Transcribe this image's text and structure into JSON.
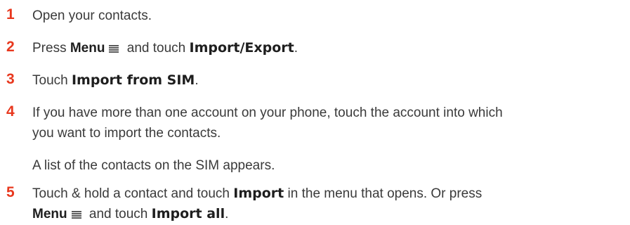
{
  "steps": [
    {
      "number": "1",
      "text": "Open your contacts."
    },
    {
      "number": "2",
      "pre": "Press ",
      "menu": "Menu",
      "mid": " and touch ",
      "target": "Import/Export",
      "post": "."
    },
    {
      "number": "3",
      "pre": "Touch ",
      "target": "Import from SIM",
      "post": "."
    },
    {
      "number": "4",
      "line1": "If you have more than one account on your phone, touch the account into which",
      "line2": "you want to import the contacts.",
      "note": "A list of the contacts on the SIM appears."
    },
    {
      "number": "5",
      "pre": "Touch & hold a contact and touch ",
      "target": "Import",
      "mid": " in the menu that opens. Or press",
      "menu": "Menu",
      "mid2": " and touch ",
      "target2": "Import all",
      "post": "."
    }
  ],
  "colors": {
    "step_number": "#e8381e",
    "body_text": "#3a3a3a"
  },
  "icons": {
    "menu": "menu-lines-icon"
  }
}
